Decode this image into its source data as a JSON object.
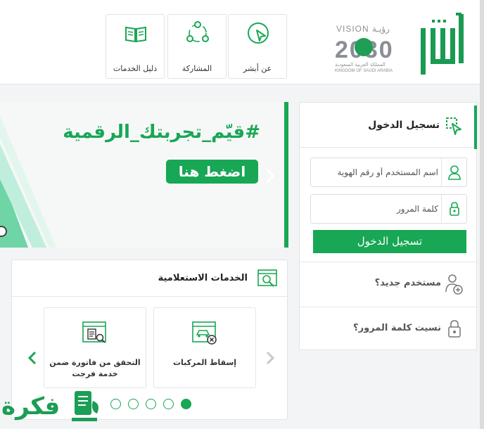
{
  "header": {
    "vision": {
      "title": "VISION",
      "title_ar": "رؤيـة",
      "year": "2030",
      "subtitle_ar": "المملكة العربية السعودية",
      "subtitle_en": "KINGDOM OF SAUDI ARABIA"
    },
    "cards": [
      {
        "label": "عن أبشر",
        "icon": "cursor-click-icon"
      },
      {
        "label": "المشاركة",
        "icon": "share-network-icon"
      },
      {
        "label": "دليل الخدمات",
        "icon": "book-icon"
      }
    ]
  },
  "banner": {
    "title": "#قيّم_تجربتك_الرقمية",
    "cta": "اضغط هنا"
  },
  "login": {
    "title": "تسجيل الدخول",
    "username_placeholder": "اسم المستخدم أو رقم الهوية",
    "password_placeholder": "كلمة المرور",
    "submit": "تسجيل الدخول",
    "new_user": "مستخدم جديد؟",
    "forgot_password": "نسيت كلمة المرور؟"
  },
  "services": {
    "title": "الخدمات الاستعلامية",
    "items": [
      {
        "label": "إسقاط المركبات",
        "icon": "vehicle-cancel-icon"
      },
      {
        "label": "التحقق من فاتورة ضمن خدمة فرجت",
        "icon": "invoice-search-icon"
      }
    ],
    "pagination": {
      "total": 5,
      "active": 1
    }
  },
  "watermark": {
    "text": "فكرة"
  },
  "colors": {
    "accent": "#18a755",
    "border": "#e3e3e3",
    "background": "#f3f4f5"
  }
}
